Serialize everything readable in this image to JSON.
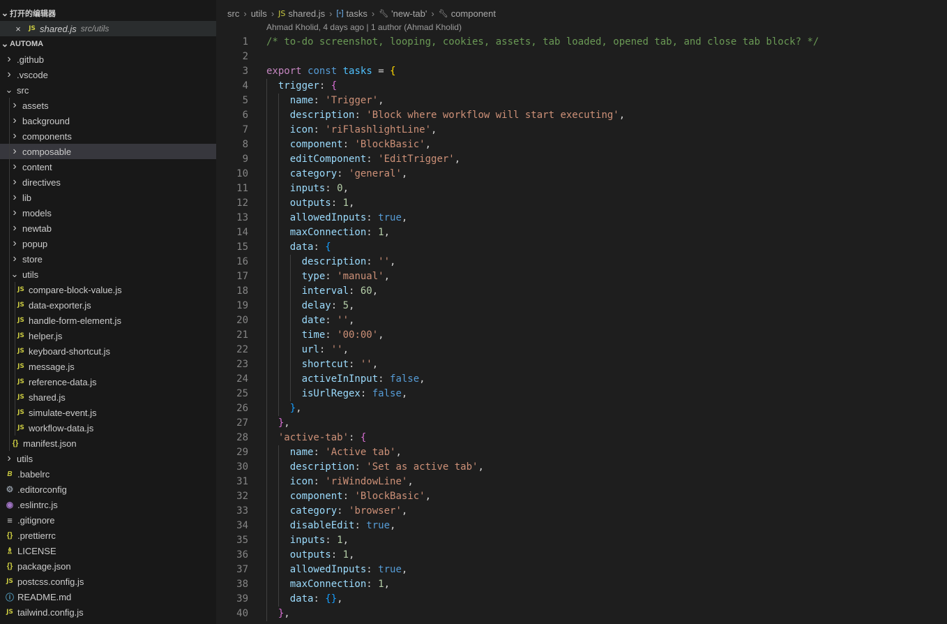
{
  "sidebar": {
    "open_editors_title": "打开的编辑器",
    "open_file": {
      "name": "shared.js",
      "path": "src/utils"
    },
    "project_title": "AUTOMA",
    "items": [
      {
        "label": ".github",
        "depth": 0,
        "kind": "folder"
      },
      {
        "label": ".vscode",
        "depth": 0,
        "kind": "folder"
      },
      {
        "label": "src",
        "depth": 0,
        "kind": "folder-open"
      },
      {
        "label": "assets",
        "depth": 1,
        "kind": "folder"
      },
      {
        "label": "background",
        "depth": 1,
        "kind": "folder"
      },
      {
        "label": "components",
        "depth": 1,
        "kind": "folder"
      },
      {
        "label": "composable",
        "depth": 1,
        "kind": "folder",
        "selected": true
      },
      {
        "label": "content",
        "depth": 1,
        "kind": "folder"
      },
      {
        "label": "directives",
        "depth": 1,
        "kind": "folder"
      },
      {
        "label": "lib",
        "depth": 1,
        "kind": "folder"
      },
      {
        "label": "models",
        "depth": 1,
        "kind": "folder"
      },
      {
        "label": "newtab",
        "depth": 1,
        "kind": "folder"
      },
      {
        "label": "popup",
        "depth": 1,
        "kind": "folder"
      },
      {
        "label": "store",
        "depth": 1,
        "kind": "folder"
      },
      {
        "label": "utils",
        "depth": 1,
        "kind": "folder-open"
      },
      {
        "label": "compare-block-value.js",
        "depth": 2,
        "kind": "js"
      },
      {
        "label": "data-exporter.js",
        "depth": 2,
        "kind": "js"
      },
      {
        "label": "handle-form-element.js",
        "depth": 2,
        "kind": "js"
      },
      {
        "label": "helper.js",
        "depth": 2,
        "kind": "js"
      },
      {
        "label": "keyboard-shortcut.js",
        "depth": 2,
        "kind": "js"
      },
      {
        "label": "message.js",
        "depth": 2,
        "kind": "js"
      },
      {
        "label": "reference-data.js",
        "depth": 2,
        "kind": "js"
      },
      {
        "label": "shared.js",
        "depth": 2,
        "kind": "js"
      },
      {
        "label": "simulate-event.js",
        "depth": 2,
        "kind": "js"
      },
      {
        "label": "workflow-data.js",
        "depth": 2,
        "kind": "js"
      },
      {
        "label": "manifest.json",
        "depth": 1,
        "kind": "json"
      },
      {
        "label": "utils",
        "depth": 0,
        "kind": "folder"
      },
      {
        "label": ".babelrc",
        "depth": 0,
        "kind": "babel"
      },
      {
        "label": ".editorconfig",
        "depth": 0,
        "kind": "gear"
      },
      {
        "label": ".eslintrc.js",
        "depth": 0,
        "kind": "eslint"
      },
      {
        "label": ".gitignore",
        "depth": 0,
        "kind": "lines"
      },
      {
        "label": ".prettierrc",
        "depth": 0,
        "kind": "json"
      },
      {
        "label": "LICENSE",
        "depth": 0,
        "kind": "license"
      },
      {
        "label": "package.json",
        "depth": 0,
        "kind": "json"
      },
      {
        "label": "postcss.config.js",
        "depth": 0,
        "kind": "js"
      },
      {
        "label": "README.md",
        "depth": 0,
        "kind": "info"
      },
      {
        "label": "tailwind.config.js",
        "depth": 0,
        "kind": "js"
      }
    ]
  },
  "breadcrumb": [
    "src",
    "utils",
    "shared.js",
    "tasks",
    "'new-tab'",
    "component"
  ],
  "blame": "Ahmad Kholid, 4 days ago | 1 author (Ahmad Kholid)",
  "icons": {
    "js": "JS",
    "json": "{}",
    "folder_closed": ">",
    "folder_open": "v",
    "close": "×"
  },
  "code": [
    [
      [
        "c",
        "/* to-do screenshot, looping, cookies, assets, tab loaded, opened tab, and close tab block? */"
      ]
    ],
    [],
    [
      [
        "k",
        "export"
      ],
      [
        "p",
        " "
      ],
      [
        "k2",
        "const"
      ],
      [
        "p",
        " "
      ],
      [
        "i",
        "tasks"
      ],
      [
        "p",
        " = "
      ],
      [
        "b1",
        "{"
      ]
    ],
    [
      [
        "p",
        "  "
      ],
      [
        "pr",
        "trigger"
      ],
      [
        "p",
        ": "
      ],
      [
        "b2",
        "{"
      ]
    ],
    [
      [
        "p",
        "    "
      ],
      [
        "pr",
        "name"
      ],
      [
        "p",
        ": "
      ],
      [
        "s",
        "'Trigger'"
      ],
      [
        "p",
        ","
      ]
    ],
    [
      [
        "p",
        "    "
      ],
      [
        "pr",
        "description"
      ],
      [
        "p",
        ": "
      ],
      [
        "s",
        "'Block where workflow will start executing'"
      ],
      [
        "p",
        ","
      ]
    ],
    [
      [
        "p",
        "    "
      ],
      [
        "pr",
        "icon"
      ],
      [
        "p",
        ": "
      ],
      [
        "s",
        "'riFlashlightLine'"
      ],
      [
        "p",
        ","
      ]
    ],
    [
      [
        "p",
        "    "
      ],
      [
        "pr",
        "component"
      ],
      [
        "p",
        ": "
      ],
      [
        "s",
        "'BlockBasic'"
      ],
      [
        "p",
        ","
      ]
    ],
    [
      [
        "p",
        "    "
      ],
      [
        "pr",
        "editComponent"
      ],
      [
        "p",
        ": "
      ],
      [
        "s",
        "'EditTrigger'"
      ],
      [
        "p",
        ","
      ]
    ],
    [
      [
        "p",
        "    "
      ],
      [
        "pr",
        "category"
      ],
      [
        "p",
        ": "
      ],
      [
        "s",
        "'general'"
      ],
      [
        "p",
        ","
      ]
    ],
    [
      [
        "p",
        "    "
      ],
      [
        "pr",
        "inputs"
      ],
      [
        "p",
        ": "
      ],
      [
        "n",
        "0"
      ],
      [
        "p",
        ","
      ]
    ],
    [
      [
        "p",
        "    "
      ],
      [
        "pr",
        "outputs"
      ],
      [
        "p",
        ": "
      ],
      [
        "n",
        "1"
      ],
      [
        "p",
        ","
      ]
    ],
    [
      [
        "p",
        "    "
      ],
      [
        "pr",
        "allowedInputs"
      ],
      [
        "p",
        ": "
      ],
      [
        "bo",
        "true"
      ],
      [
        "p",
        ","
      ]
    ],
    [
      [
        "p",
        "    "
      ],
      [
        "pr",
        "maxConnection"
      ],
      [
        "p",
        ": "
      ],
      [
        "n",
        "1"
      ],
      [
        "p",
        ","
      ]
    ],
    [
      [
        "p",
        "    "
      ],
      [
        "pr",
        "data"
      ],
      [
        "p",
        ": "
      ],
      [
        "b3",
        "{"
      ]
    ],
    [
      [
        "p",
        "      "
      ],
      [
        "pr",
        "description"
      ],
      [
        "p",
        ": "
      ],
      [
        "s",
        "''"
      ],
      [
        "p",
        ","
      ]
    ],
    [
      [
        "p",
        "      "
      ],
      [
        "pr",
        "type"
      ],
      [
        "p",
        ": "
      ],
      [
        "s",
        "'manual'"
      ],
      [
        "p",
        ","
      ]
    ],
    [
      [
        "p",
        "      "
      ],
      [
        "pr",
        "interval"
      ],
      [
        "p",
        ": "
      ],
      [
        "n",
        "60"
      ],
      [
        "p",
        ","
      ]
    ],
    [
      [
        "p",
        "      "
      ],
      [
        "pr",
        "delay"
      ],
      [
        "p",
        ": "
      ],
      [
        "n",
        "5"
      ],
      [
        "p",
        ","
      ]
    ],
    [
      [
        "p",
        "      "
      ],
      [
        "pr",
        "date"
      ],
      [
        "p",
        ": "
      ],
      [
        "s",
        "''"
      ],
      [
        "p",
        ","
      ]
    ],
    [
      [
        "p",
        "      "
      ],
      [
        "pr",
        "time"
      ],
      [
        "p",
        ": "
      ],
      [
        "s",
        "'00:00'"
      ],
      [
        "p",
        ","
      ]
    ],
    [
      [
        "p",
        "      "
      ],
      [
        "pr",
        "url"
      ],
      [
        "p",
        ": "
      ],
      [
        "s",
        "''"
      ],
      [
        "p",
        ","
      ]
    ],
    [
      [
        "p",
        "      "
      ],
      [
        "pr",
        "shortcut"
      ],
      [
        "p",
        ": "
      ],
      [
        "s",
        "''"
      ],
      [
        "p",
        ","
      ]
    ],
    [
      [
        "p",
        "      "
      ],
      [
        "pr",
        "activeInInput"
      ],
      [
        "p",
        ": "
      ],
      [
        "bo",
        "false"
      ],
      [
        "p",
        ","
      ]
    ],
    [
      [
        "p",
        "      "
      ],
      [
        "pr",
        "isUrlRegex"
      ],
      [
        "p",
        ": "
      ],
      [
        "bo",
        "false"
      ],
      [
        "p",
        ","
      ]
    ],
    [
      [
        "p",
        "    "
      ],
      [
        "b3",
        "}"
      ],
      [
        "p",
        ","
      ]
    ],
    [
      [
        "p",
        "  "
      ],
      [
        "b2",
        "}"
      ],
      [
        "p",
        ","
      ]
    ],
    [
      [
        "p",
        "  "
      ],
      [
        "s",
        "'active-tab'"
      ],
      [
        "p",
        ": "
      ],
      [
        "b2",
        "{"
      ]
    ],
    [
      [
        "p",
        "    "
      ],
      [
        "pr",
        "name"
      ],
      [
        "p",
        ": "
      ],
      [
        "s",
        "'Active tab'"
      ],
      [
        "p",
        ","
      ]
    ],
    [
      [
        "p",
        "    "
      ],
      [
        "pr",
        "description"
      ],
      [
        "p",
        ": "
      ],
      [
        "s",
        "'Set as active tab'"
      ],
      [
        "p",
        ","
      ]
    ],
    [
      [
        "p",
        "    "
      ],
      [
        "pr",
        "icon"
      ],
      [
        "p",
        ": "
      ],
      [
        "s",
        "'riWindowLine'"
      ],
      [
        "p",
        ","
      ]
    ],
    [
      [
        "p",
        "    "
      ],
      [
        "pr",
        "component"
      ],
      [
        "p",
        ": "
      ],
      [
        "s",
        "'BlockBasic'"
      ],
      [
        "p",
        ","
      ]
    ],
    [
      [
        "p",
        "    "
      ],
      [
        "pr",
        "category"
      ],
      [
        "p",
        ": "
      ],
      [
        "s",
        "'browser'"
      ],
      [
        "p",
        ","
      ]
    ],
    [
      [
        "p",
        "    "
      ],
      [
        "pr",
        "disableEdit"
      ],
      [
        "p",
        ": "
      ],
      [
        "bo",
        "true"
      ],
      [
        "p",
        ","
      ]
    ],
    [
      [
        "p",
        "    "
      ],
      [
        "pr",
        "inputs"
      ],
      [
        "p",
        ": "
      ],
      [
        "n",
        "1"
      ],
      [
        "p",
        ","
      ]
    ],
    [
      [
        "p",
        "    "
      ],
      [
        "pr",
        "outputs"
      ],
      [
        "p",
        ": "
      ],
      [
        "n",
        "1"
      ],
      [
        "p",
        ","
      ]
    ],
    [
      [
        "p",
        "    "
      ],
      [
        "pr",
        "allowedInputs"
      ],
      [
        "p",
        ": "
      ],
      [
        "bo",
        "true"
      ],
      [
        "p",
        ","
      ]
    ],
    [
      [
        "p",
        "    "
      ],
      [
        "pr",
        "maxConnection"
      ],
      [
        "p",
        ": "
      ],
      [
        "n",
        "1"
      ],
      [
        "p",
        ","
      ]
    ],
    [
      [
        "p",
        "    "
      ],
      [
        "pr",
        "data"
      ],
      [
        "p",
        ": "
      ],
      [
        "b3",
        "{}"
      ],
      [
        "p",
        ","
      ]
    ],
    [
      [
        "p",
        "  "
      ],
      [
        "b2",
        "}"
      ],
      [
        "p",
        ","
      ]
    ]
  ]
}
